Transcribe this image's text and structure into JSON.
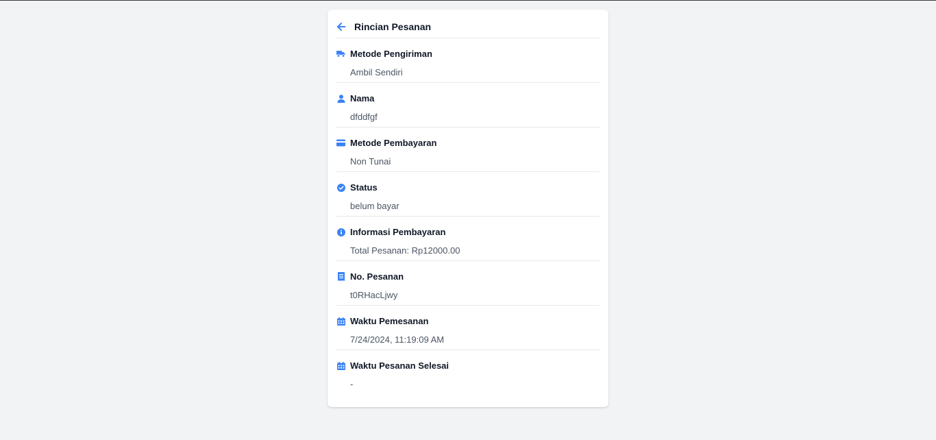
{
  "header": {
    "title": "Rincian Pesanan"
  },
  "accent_color": "#3b82f6",
  "rows": [
    {
      "icon": "truck-icon",
      "label": "Metode Pengiriman",
      "value": "Ambil Sendiri"
    },
    {
      "icon": "user-icon",
      "label": "Nama",
      "value": "dfddfgf"
    },
    {
      "icon": "credit-card-icon",
      "label": "Metode Pembayaran",
      "value": "Non Tunai"
    },
    {
      "icon": "check-circle-icon",
      "label": "Status",
      "value": "belum bayar"
    },
    {
      "icon": "info-circle-icon",
      "label": "Informasi Pembayaran",
      "value": "Total Pesanan: Rp12000.00"
    },
    {
      "icon": "receipt-icon",
      "label": "No. Pesanan",
      "value": "t0RHacLjwy"
    },
    {
      "icon": "calendar-icon",
      "label": "Waktu Pemesanan",
      "value": "7/24/2024, 11:19:09 AM"
    },
    {
      "icon": "calendar-icon",
      "label": "Waktu Pesanan Selesai",
      "value": "-"
    }
  ]
}
